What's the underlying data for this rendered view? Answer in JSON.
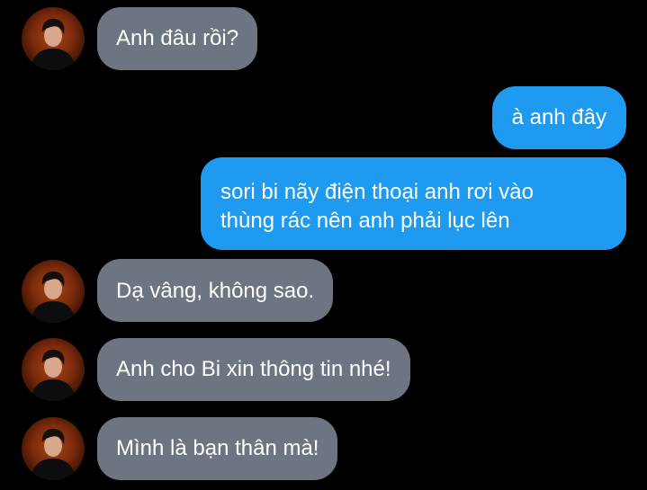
{
  "contact": {
    "avatar_icon": "contact-avatar-photo"
  },
  "messages": [
    {
      "id": "m1",
      "direction": "received",
      "text": "Anh đâu rồi?"
    },
    {
      "id": "m2",
      "direction": "sent",
      "text": "à anh đây"
    },
    {
      "id": "m3",
      "direction": "sent",
      "lines": [
        "sori bi nãy điện thoại anh rơi vào",
        "thùng rác nên anh phải lục lên"
      ]
    },
    {
      "id": "m4",
      "direction": "received",
      "text": "Dạ vâng, không sao."
    },
    {
      "id": "m5",
      "direction": "received",
      "text": "Anh cho Bi xin thông tin nhé!"
    },
    {
      "id": "m6",
      "direction": "received",
      "text": "Mình là bạn thân mà!"
    }
  ],
  "colors": {
    "background": "#000000",
    "received_bubble": "#6e7582",
    "sent_bubble": "#1e9bf0",
    "text": "#ffffff"
  }
}
